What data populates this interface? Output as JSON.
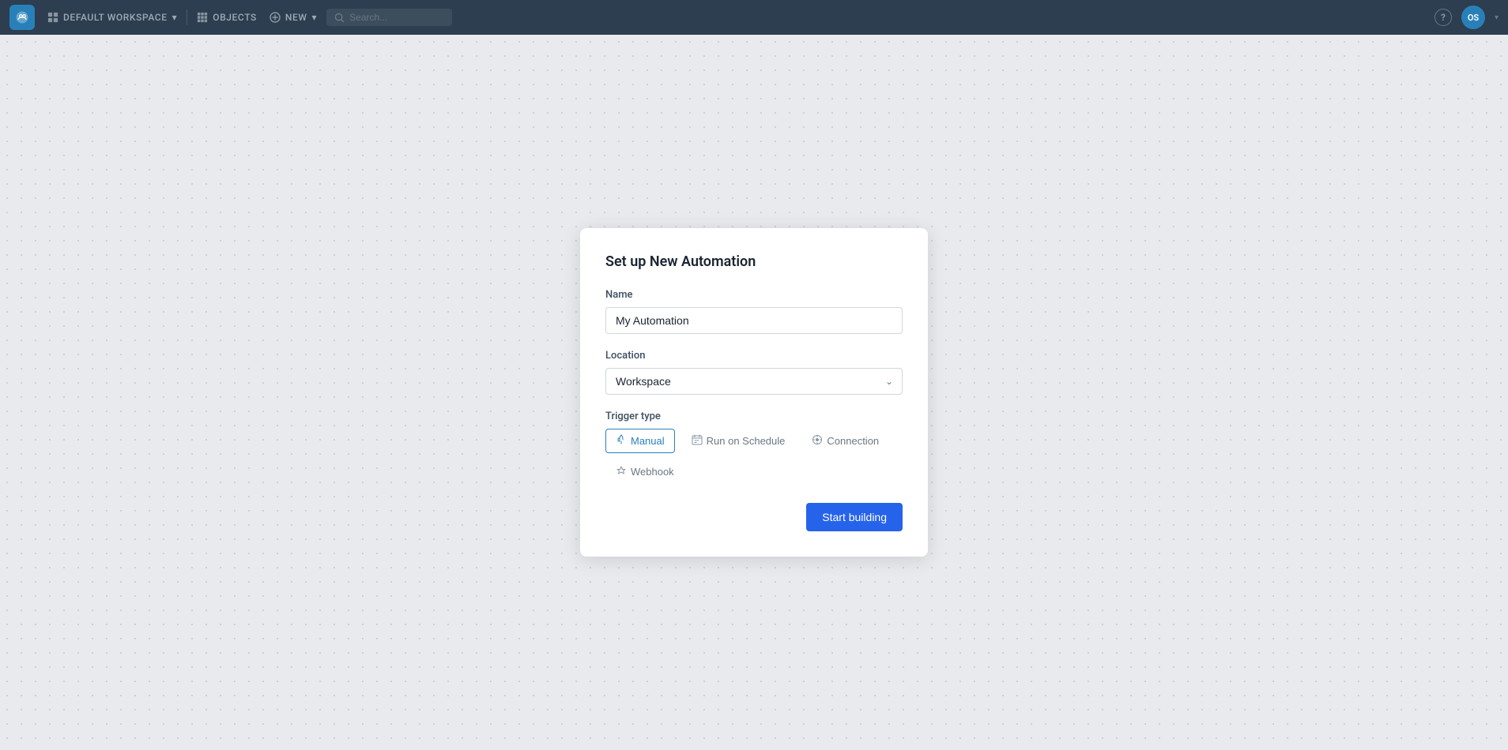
{
  "navbar": {
    "logo_alt": "Workato logo",
    "workspace_label": "DEFAULT WORKSPACE",
    "objects_label": "OBJECTS",
    "new_label": "NEW",
    "search_placeholder": "Search...",
    "help_label": "?",
    "avatar_initials": "OS",
    "avatar_chevron": "▾"
  },
  "dialog": {
    "title": "Set up New Automation",
    "name_label": "Name",
    "name_value": "My Automation",
    "location_label": "Location",
    "location_value": "Workspace",
    "trigger_label": "Trigger type",
    "triggers": [
      {
        "id": "manual",
        "label": "Manual",
        "icon": "☝",
        "active": true
      },
      {
        "id": "schedule",
        "label": "Run on Schedule",
        "icon": "⊟",
        "active": false
      },
      {
        "id": "connection",
        "label": "Connection",
        "icon": "⊙",
        "active": false
      },
      {
        "id": "webhook",
        "label": "Webhook",
        "icon": "✦",
        "active": false
      }
    ],
    "submit_label": "Start building"
  }
}
